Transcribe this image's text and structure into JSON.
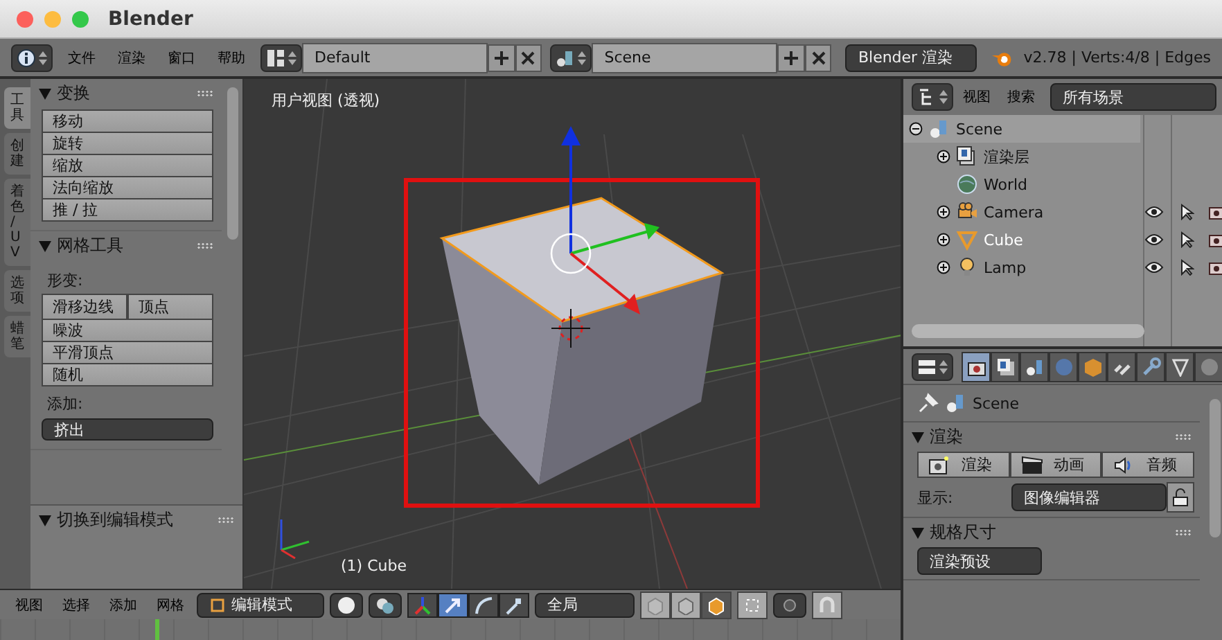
{
  "window": {
    "title": "Blender"
  },
  "top_bar": {
    "menus": [
      "文件",
      "渲染",
      "窗口",
      "帮助"
    ],
    "layout": "Default",
    "scene": "Scene",
    "engine": "Blender 渲染",
    "stats": "v2.78 | Verts:4/8 | Edges"
  },
  "tool_tabs": [
    {
      "label": "工具",
      "selected": true
    },
    {
      "label": "创建",
      "selected": false
    },
    {
      "label": "着色 / UV",
      "selected": false
    },
    {
      "label": "选项",
      "selected": false
    },
    {
      "label": "蜡笔",
      "selected": false
    }
  ],
  "tool_panels": [
    {
      "title": "变换",
      "items": [
        {
          "kind": "button",
          "label": "移动"
        },
        {
          "kind": "button",
          "label": "旋转"
        },
        {
          "kind": "button",
          "label": "缩放"
        },
        {
          "kind": "button",
          "label": "法向缩放"
        },
        {
          "kind": "button",
          "label": "推 / 拉"
        }
      ]
    },
    {
      "title": "网格工具",
      "items": [
        {
          "kind": "label",
          "label": "形变:"
        },
        {
          "kind": "row",
          "labels": [
            "滑移边线",
            "顶点"
          ]
        },
        {
          "kind": "button",
          "label": "噪波"
        },
        {
          "kind": "button",
          "label": "平滑顶点"
        },
        {
          "kind": "button",
          "label": "随机"
        },
        {
          "kind": "label",
          "label": "添加:"
        },
        {
          "kind": "dropdown",
          "label": "挤出"
        }
      ]
    }
  ],
  "operator_panel": {
    "title": "切换到编辑模式"
  },
  "viewport": {
    "view_label": "用户视图 (透视)",
    "object_label": "(1) Cube"
  },
  "outliner": {
    "menus": [
      "视图",
      "搜索"
    ],
    "filter": "所有场景",
    "tree": [
      {
        "name": "Scene",
        "kind": "scene",
        "expanded": true,
        "selected": true,
        "active": false,
        "children": [
          {
            "name": "渲染层",
            "kind": "renderlayer",
            "expanded": false,
            "selected": false,
            "active": false
          },
          {
            "name": "World",
            "kind": "world",
            "selected": false,
            "active": false
          },
          {
            "name": "Camera",
            "kind": "camera",
            "expanded": false,
            "selected": false,
            "active": false
          },
          {
            "name": "Cube",
            "kind": "mesh",
            "expanded": false,
            "selected": false,
            "active": true
          },
          {
            "name": "Lamp",
            "kind": "lamp",
            "expanded": false,
            "selected": false,
            "active": false
          }
        ]
      }
    ]
  },
  "properties": {
    "tabs": [
      {
        "kind": "camera",
        "selected": true
      },
      {
        "kind": "layers",
        "selected": false
      },
      {
        "kind": "spheres",
        "selected": false
      },
      {
        "kind": "globe",
        "selected": false
      },
      {
        "kind": "cube",
        "selected": false
      },
      {
        "kind": "chain",
        "selected": false
      },
      {
        "kind": "wrench",
        "selected": false
      },
      {
        "kind": "triangle",
        "selected": false
      },
      {
        "kind": "sphere",
        "selected": false
      }
    ],
    "context": "Scene",
    "render_panel": {
      "title": "渲染",
      "buttons": [
        {
          "kind": "camera",
          "label": "渲染"
        },
        {
          "kind": "clapper",
          "label": "动画"
        },
        {
          "kind": "speaker",
          "label": "音频"
        }
      ],
      "display_label": "显示:",
      "display_value": "图像编辑器"
    },
    "dimensions_panel": {
      "title": "规格尺寸",
      "preset": "渲染预设"
    }
  },
  "bottom_bar": {
    "menus": [
      "视图",
      "选择",
      "添加",
      "网格"
    ],
    "mode": "编辑模式",
    "orientation": "全局",
    "manipulators": [
      {
        "kind": "axes",
        "selected": false
      },
      {
        "kind": "translate",
        "selected": true
      },
      {
        "kind": "rotate",
        "selected": false
      },
      {
        "kind": "scale",
        "selected": false
      }
    ]
  }
}
